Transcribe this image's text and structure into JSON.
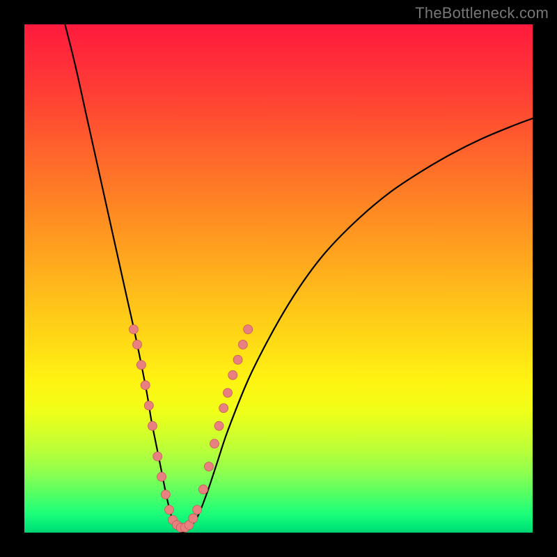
{
  "watermark": "TheBottleneck.com",
  "chart_data": {
    "type": "line",
    "title": "",
    "xlabel": "",
    "ylabel": "",
    "xlim": [
      0,
      100
    ],
    "ylim": [
      0,
      100
    ],
    "grid": false,
    "legend": false,
    "series": [
      {
        "name": "bottleneck-curve",
        "x": [
          8,
          10,
          12,
          14,
          16,
          18,
          20,
          22,
          24,
          25,
          26,
          27,
          28,
          29,
          30,
          31,
          32,
          34,
          36,
          38,
          40,
          44,
          48,
          52,
          56,
          60,
          66,
          72,
          78,
          84,
          90,
          96,
          100
        ],
        "y": [
          100,
          92,
          83,
          74,
          65,
          56,
          47,
          38,
          28,
          22,
          17,
          12,
          7,
          3,
          1,
          0,
          0.5,
          3,
          8,
          14,
          20,
          30,
          38,
          45,
          51,
          56,
          62,
          67,
          71,
          74.5,
          77.5,
          80,
          81.5
        ]
      }
    ],
    "markers": {
      "name": "highlight-dots",
      "points": [
        {
          "x": 21.5,
          "y": 40
        },
        {
          "x": 22.2,
          "y": 37
        },
        {
          "x": 23.0,
          "y": 33
        },
        {
          "x": 23.8,
          "y": 29
        },
        {
          "x": 24.5,
          "y": 25
        },
        {
          "x": 25.2,
          "y": 21
        },
        {
          "x": 26.2,
          "y": 15
        },
        {
          "x": 27.0,
          "y": 11
        },
        {
          "x": 27.8,
          "y": 7.5
        },
        {
          "x": 28.5,
          "y": 4.5
        },
        {
          "x": 29.2,
          "y": 2.5
        },
        {
          "x": 30.0,
          "y": 1.5
        },
        {
          "x": 30.8,
          "y": 1.0
        },
        {
          "x": 31.6,
          "y": 1.0
        },
        {
          "x": 32.4,
          "y": 1.5
        },
        {
          "x": 33.2,
          "y": 2.8
        },
        {
          "x": 34.0,
          "y": 4.5
        },
        {
          "x": 35.2,
          "y": 8.5
        },
        {
          "x": 36.3,
          "y": 13
        },
        {
          "x": 37.4,
          "y": 17.5
        },
        {
          "x": 38.3,
          "y": 21
        },
        {
          "x": 39.2,
          "y": 24.5
        },
        {
          "x": 40.0,
          "y": 27.5
        },
        {
          "x": 41.0,
          "y": 31
        },
        {
          "x": 42.0,
          "y": 34
        },
        {
          "x": 43.0,
          "y": 37
        },
        {
          "x": 44.0,
          "y": 40
        }
      ]
    },
    "background_gradient": {
      "top": "#ff1a3c",
      "bottom": "#00d070"
    }
  }
}
